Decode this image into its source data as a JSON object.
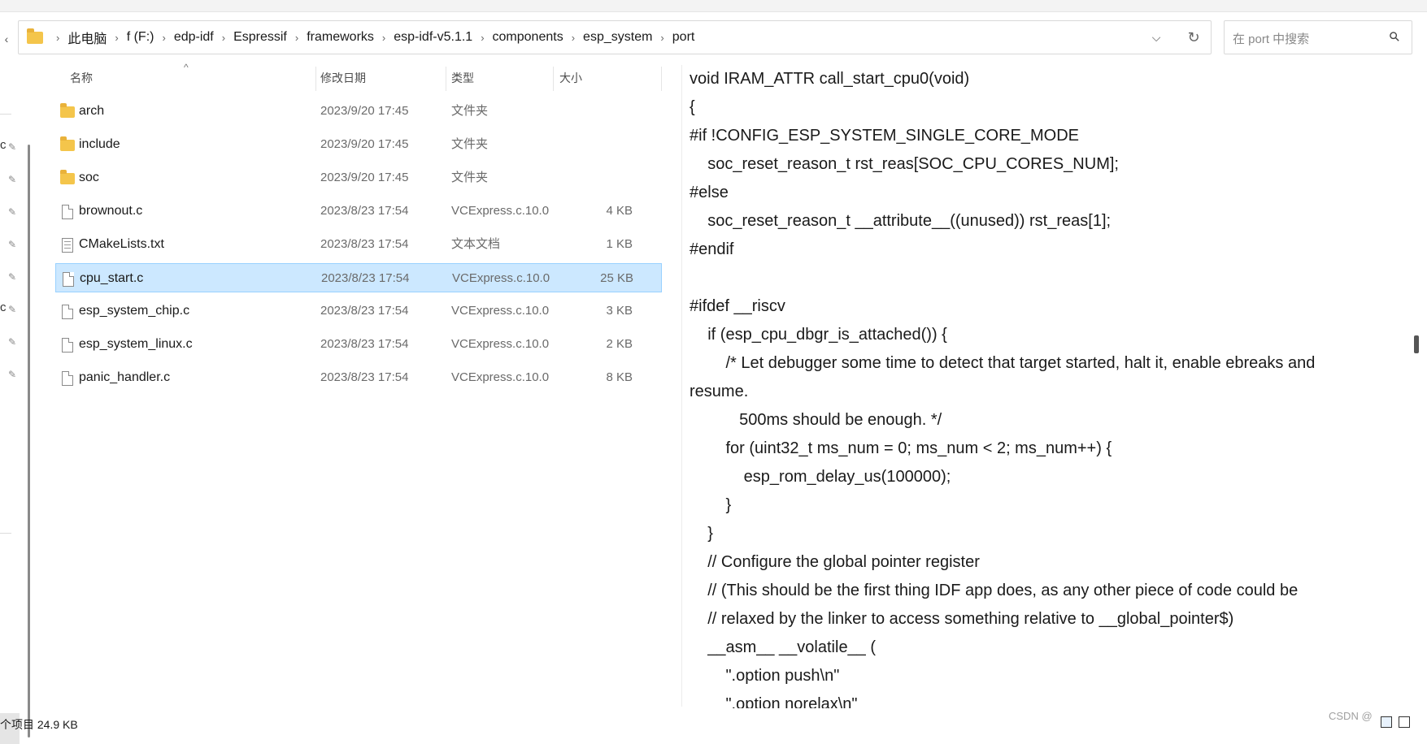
{
  "address_bar": {
    "breadcrumbs": [
      "此电脑",
      "f (F:)",
      "edp-idf",
      "Espressif",
      "frameworks",
      "esp-idf-v5.1.1",
      "components",
      "esp_system",
      "port"
    ]
  },
  "search": {
    "placeholder": "在 port 中搜索"
  },
  "file_list": {
    "columns": {
      "name": "名称",
      "date": "修改日期",
      "type": "类型",
      "size": "大小"
    },
    "items": [
      {
        "name": "arch",
        "date": "2023/9/20 17:45",
        "type": "文件夹",
        "size": "",
        "icon": "folder-icon"
      },
      {
        "name": "include",
        "date": "2023/9/20 17:45",
        "type": "文件夹",
        "size": "",
        "icon": "folder-icon"
      },
      {
        "name": "soc",
        "date": "2023/9/20 17:45",
        "type": "文件夹",
        "size": "",
        "icon": "folder-icon"
      },
      {
        "name": "brownout.c",
        "date": "2023/8/23 17:54",
        "type": "VCExpress.c.10.0",
        "size": "4 KB",
        "icon": "c-file-icon"
      },
      {
        "name": "CMakeLists.txt",
        "date": "2023/8/23 17:54",
        "type": "文本文档",
        "size": "1 KB",
        "icon": "text-file-icon"
      },
      {
        "name": "cpu_start.c",
        "date": "2023/8/23 17:54",
        "type": "VCExpress.c.10.0",
        "size": "25 KB",
        "icon": "c-file-icon",
        "selected": true
      },
      {
        "name": "esp_system_chip.c",
        "date": "2023/8/23 17:54",
        "type": "VCExpress.c.10.0",
        "size": "3 KB",
        "icon": "c-file-icon"
      },
      {
        "name": "esp_system_linux.c",
        "date": "2023/8/23 17:54",
        "type": "VCExpress.c.10.0",
        "size": "2 KB",
        "icon": "c-file-icon"
      },
      {
        "name": "panic_handler.c",
        "date": "2023/8/23 17:54",
        "type": "VCExpress.c.10.0",
        "size": "8 KB",
        "icon": "c-file-icon"
      }
    ]
  },
  "left_pane": {
    "cut_labels": [
      "c",
      "c"
    ]
  },
  "code": {
    "lines": [
      "void IRAM_ATTR call_start_cpu0(void)",
      "{",
      "#if !CONFIG_ESP_SYSTEM_SINGLE_CORE_MODE",
      "    soc_reset_reason_t rst_reas[SOC_CPU_CORES_NUM];",
      "#else",
      "    soc_reset_reason_t __attribute__((unused)) rst_reas[1];",
      "#endif",
      "",
      "#ifdef __riscv",
      "    if (esp_cpu_dbgr_is_attached()) {",
      "        /* Let debugger some time to detect that target started, halt it, enable ebreaks and",
      "resume.",
      "           500ms should be enough. */",
      "        for (uint32_t ms_num = 0; ms_num < 2; ms_num++) {",
      "            esp_rom_delay_us(100000);",
      "        }",
      "    }",
      "    // Configure the global pointer register",
      "    // (This should be the first thing IDF app does, as any other piece of code could be",
      "    // relaxed by the linker to access something relative to __global_pointer$)",
      "    __asm__ __volatile__ (",
      "        \".option push\\n\"",
      "        \".option norelax\\n\""
    ]
  },
  "status": {
    "text": "个项目  24.9 KB"
  },
  "watermark": {
    "text": "CSDN @"
  }
}
